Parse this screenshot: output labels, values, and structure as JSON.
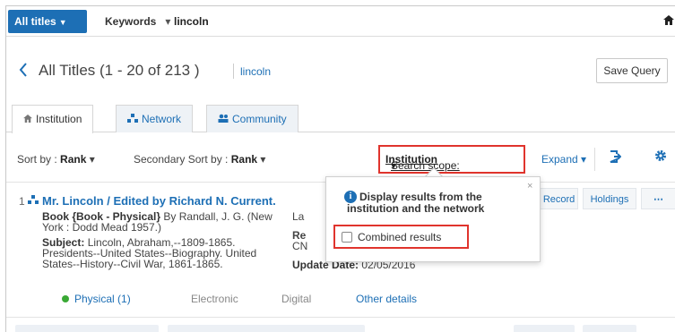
{
  "searchbar": {
    "scope_button": "All titles",
    "field_select": "Keywords",
    "query_value": "lincoln",
    "home_icon": "home-icon"
  },
  "header": {
    "back_icon": "chevron-left-icon",
    "title": "All Titles (1 - 20 of 213 )",
    "query_link": "lincoln",
    "save_query": "Save Query"
  },
  "tabs": [
    {
      "label": "Institution",
      "icon": "home-icon"
    },
    {
      "label": "Network",
      "icon": "network-icon"
    },
    {
      "label": "Community",
      "icon": "community-icon"
    }
  ],
  "sort": {
    "sort_by_label": "Sort by :",
    "sort_by_value": "Rank",
    "secondary_label": "Secondary Sort by :",
    "secondary_value": "Rank",
    "scope_label": "Search scope:",
    "scope_value": "Institution",
    "expand": "Expand"
  },
  "popover": {
    "message": "Display results from the institution and the network",
    "checkbox_label": "Combined results",
    "checked": false,
    "close": "×"
  },
  "result": {
    "number": "1",
    "title": "Mr. Lincoln / Edited by Richard N. Current.",
    "type": "Book {Book - Physical}",
    "by": "By Randall, J. G. (New",
    "publisher": "York : Dodd Mead 1957.)",
    "subject_label": "Subject:",
    "subject_line1": "Lincoln, Abraham,--1809-1865.",
    "subject_line2": "Presidents--United States--Biography. United",
    "subject_line3": "States--History--Civil War, 1861-1865.",
    "right_col1": "La",
    "right_col2": "Re",
    "right_col3": "CN",
    "update_label": "Update Date:",
    "update_value": "02/05/2016",
    "actions": [
      "t Record",
      "Holdings",
      "⋯"
    ],
    "availability": {
      "physical": "Physical (1)",
      "electronic": "Electronic",
      "digital": "Digital",
      "details": "Other details"
    }
  }
}
